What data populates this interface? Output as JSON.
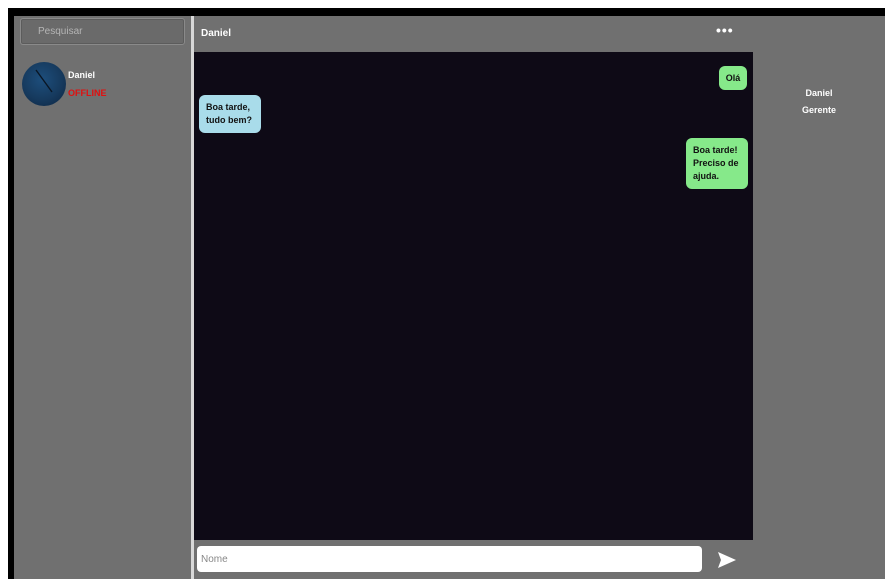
{
  "sidebar": {
    "search": {
      "placeholder": "Pesquisar"
    },
    "contacts": [
      {
        "name": "Daniel",
        "status": "OFFLINE",
        "status_color": "#e01010"
      }
    ]
  },
  "chat": {
    "title": "Daniel",
    "more_icon": "more-horizontal-icon",
    "messages": [
      {
        "side": "sent",
        "text": "Olá",
        "color": "#86e98a"
      },
      {
        "side": "received",
        "text": "Boa tarde, tudo bem?",
        "color": "#a9dcea"
      },
      {
        "side": "sent",
        "text": "Boa tarde! Preciso de ajuda.",
        "color": "#86e98a"
      }
    ],
    "composer": {
      "placeholder": "Nome",
      "send_icon": "send-icon"
    }
  },
  "profile": {
    "name": "Daniel",
    "role": "Gerente"
  }
}
